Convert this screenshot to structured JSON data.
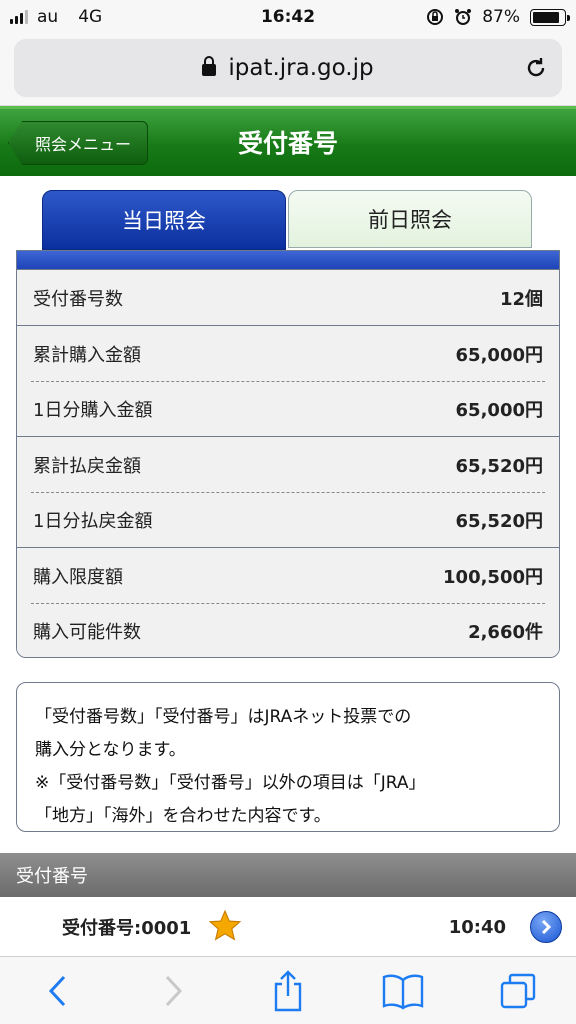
{
  "status_bar": {
    "carrier": "au",
    "network": "4G",
    "time": "16:42",
    "battery": "87%"
  },
  "browser": {
    "url": "ipat.jra.go.jp"
  },
  "header": {
    "back_label": "照会メニュー",
    "title": "受付番号"
  },
  "tabs": [
    {
      "label": "当日照会",
      "active": true
    },
    {
      "label": "前日照会",
      "active": false
    }
  ],
  "summary": {
    "receipt_count": {
      "label": "受付番号数",
      "value": "12個"
    },
    "total_purchase": {
      "label": "累計購入金額",
      "value": "65,000円"
    },
    "daily_purchase": {
      "label": "1日分購入金額",
      "value": "65,000円"
    },
    "total_refund": {
      "label": "累計払戻金額",
      "value": "65,520円"
    },
    "daily_refund": {
      "label": "1日分払戻金額",
      "value": "65,520円"
    },
    "purchase_limit": {
      "label": "購入限度額",
      "value": "100,500円"
    },
    "purchasable_count": {
      "label": "購入可能件数",
      "value": "2,660件"
    }
  },
  "note": {
    "line1": "「受付番号数」「受付番号」はJRAネット投票での",
    "line2": "購入分となります。",
    "line3": "※「受付番号数」「受付番号」以外の項目は「JRA」",
    "line4": "「地方」「海外」を合わせた内容です。"
  },
  "receipts_section": {
    "title": "受付番号"
  },
  "receipts": [
    {
      "label": "受付番号:0001",
      "time": "10:40",
      "starred": true
    }
  ],
  "colors": {
    "header_green": "#177a17",
    "tab_blue": "#0b2f9e",
    "star": "#f5a800"
  }
}
